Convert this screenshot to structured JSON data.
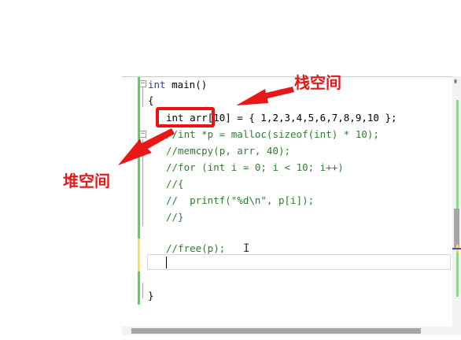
{
  "editor": {
    "lines": [
      "int main()",
      "{",
      "int arr[10] = { 1,2,3,4,5,6,7,8,9,10 };",
      "//int *p = malloc(sizeof(int) * 10);",
      "//memcpy(p, arr, 40);",
      "//for (int i = 0; i < 10; i++)",
      "//{",
      "//  printf(\"%d\\n\", p[i]);",
      "//}",
      "",
      "//free(p);",
      "",
      "",
      "}"
    ],
    "fold_open_glyph": "−"
  },
  "annotations": {
    "stack_label": "栈空间",
    "heap_label": "堆空间",
    "color": "#e81818"
  },
  "icons": {
    "split": "⇟",
    "ibeam": "I"
  }
}
